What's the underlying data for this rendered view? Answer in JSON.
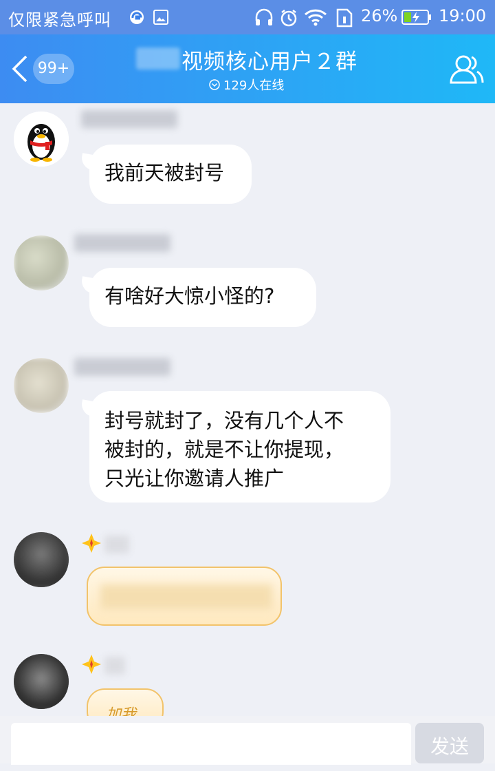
{
  "status_bar": {
    "left_text": "仅限紧急呼叫",
    "battery_percent": "26%",
    "time": "19:00",
    "icons": [
      "browser-icon",
      "image-icon",
      "headphones-icon",
      "alarm-icon",
      "wifi-icon",
      "sim-icon",
      "battery-charging-icon"
    ]
  },
  "header": {
    "unread_badge": "99+",
    "group_title": "视频核心用户２群",
    "online_count": "129人在线"
  },
  "messages": [
    {
      "text": "我前天被封号"
    },
    {
      "text": "有啥好大惊小怪的?"
    },
    {
      "line1": "封号就封了，没有几个人不",
      "line2": "被封的，就是不让你提现，",
      "line3": "只光让你邀请人推广"
    },
    {
      "text": ""
    },
    {
      "text": "加我"
    }
  ],
  "composer": {
    "input_value": "",
    "send_label": "发送"
  },
  "colors": {
    "header_start": "#3d8cf2",
    "header_end": "#1fb8f7",
    "chat_background": "#eef0f6",
    "bubble": "#ffffff",
    "gold_bubble_border": "#f2c36a"
  }
}
